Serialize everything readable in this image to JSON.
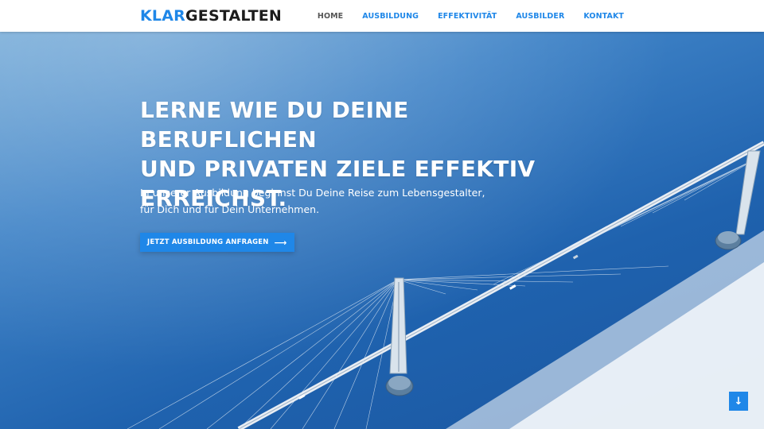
{
  "logo": {
    "part1": "KLAR",
    "part2": "GESTALTEN"
  },
  "nav": {
    "items": [
      {
        "label": "HOME",
        "active": true
      },
      {
        "label": "AUSBILDUNG"
      },
      {
        "label": "EFFEKTIVITÄT"
      },
      {
        "label": "AUSBILDER"
      },
      {
        "label": "KONTAKT"
      }
    ]
  },
  "hero": {
    "headline_lines": [
      "LERNE WIE DU DEINE BERUFLICHEN",
      "UND PRIVATEN ZIELE EFFEKTIV",
      "ERREICHST."
    ],
    "subline_lines": [
      "In unserer Ausbildung beginnst Du Deine Reise zum Lebensgestalter,",
      "für Dich und für Dein Unternehmen."
    ],
    "cta_label": "JETZT AUSBILDUNG ANFRAGEN",
    "cta_icon": "arrow-right-icon"
  },
  "scroll_button": {
    "glyph": "↓",
    "icon": "arrow-down-icon"
  },
  "colors": {
    "accent": "#1f87e8",
    "logo_dark": "#1c1c1c",
    "nav_active": "#555555",
    "hero_blue": "#1f62ae"
  }
}
